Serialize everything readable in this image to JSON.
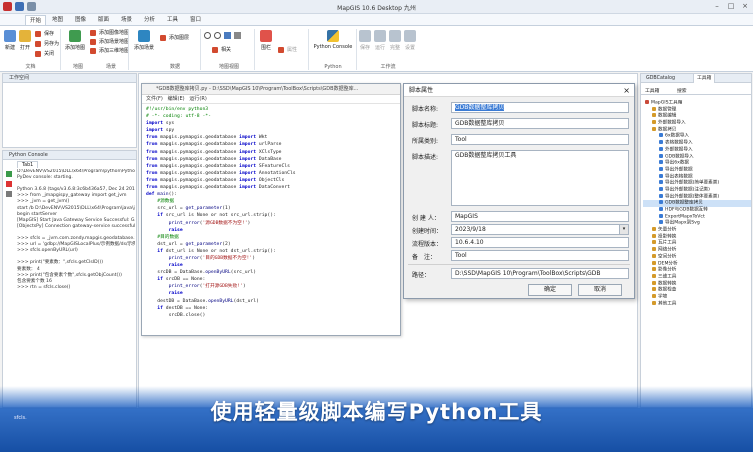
{
  "window": {
    "title": "MapGIS 10.6 Desktop 九州"
  },
  "ribbon_tabs": [
    "开始",
    "地图",
    "图像",
    "版面",
    "场景",
    "分析",
    "工具",
    "窗口"
  ],
  "ribbon": {
    "new": "新建",
    "open": "打开",
    "save": "保存",
    "save_as": "另存为",
    "close": "关闭",
    "group_doc": "文档",
    "add_map": "添加地图",
    "add_raster_map": "添加图像地图",
    "add_scene_map": "添加场景地图",
    "add_3d_map": "添加三维地图",
    "group_map": "地图",
    "group_map2": "场景",
    "add_scene": "添加场景",
    "add_layer": "添加图层",
    "group_data": "数据",
    "group_mapview": "地图视图",
    "related": "相关",
    "fence": "围栏",
    "property": "属性",
    "python_console": "Python Console",
    "group_python": "Python",
    "save2": "保存",
    "run": "运行",
    "stop": "完整",
    "settings": "设置",
    "group_workflow": "工作流"
  },
  "left_pane": {
    "title": "工作空间"
  },
  "console": {
    "title": "Python Console",
    "tab": "Tab1",
    "lines": [
      "D:\\DevENV\\VS2015\\DLL\\x64\\Program\\python\\Python36\\",
      "PyDev console: starting.",
      "",
      "Python 3.6.8 (tags/v3.6.8:3c6b436a57, Dec 24 2018, 00:16:47)",
      ">>> from _jmapgispy_gateway import get_jvm",
      ">>> _jvm = get_jvm()",
      "start /b D:\\DevENV\\VS2015\\DLL\\x64\\Program\\java\\jre",
      "begin startServer",
      "[MapGIS] Start Java Gateway Service Successful: GatewayServer",
      "[ObjectsPy] Connection gateway-service successful.",
      "",
      ">>> sfcls = _jvm.com.zondy.mapgis.geodatabase.SFeatureCls",
      ">>> url = 'gdbp://MapGISLocalPlus/示例数据/ds/示例数据",
      ">>> sfcls.openByURL(url)",
      "",
      ">>> print(\"要素数：\",sfcls.getClsID())",
      "要素数： 4",
      ">>> print(\"包含要素个数\",sfcls.getObjCount())",
      "包含要素个数 16",
      ">>> rtn = sfcls.close()"
    ],
    "input": "sfcls."
  },
  "editor": {
    "title": "*GDB数据整库拷贝.py - D:\\SSD\\MapGIS 10\\Program\\ToolBox\\Scripts\\GDB数据整库...",
    "menu": [
      "文件(F)",
      "编辑(E)",
      "运行(R)"
    ],
    "code": [
      [
        {
          "t": "#!/usr/bin/env python3",
          "c": "cm"
        }
      ],
      [
        {
          "t": "# -*- coding: utf-8 -*-",
          "c": "cm"
        }
      ],
      [
        {
          "t": "import",
          "c": "kw"
        },
        {
          "t": " sys"
        }
      ],
      [
        {
          "t": "import",
          "c": "kw"
        },
        {
          "t": " spy"
        }
      ],
      [
        {
          "t": "from",
          "c": "kw"
        },
        {
          "t": " mapgis.pymapgis.geodatabase "
        },
        {
          "t": "import",
          "c": "kw"
        },
        {
          "t": " Wkt"
        }
      ],
      [
        {
          "t": "from",
          "c": "kw"
        },
        {
          "t": " mapgis.pymapgis.geodatabase "
        },
        {
          "t": "import",
          "c": "kw"
        },
        {
          "t": " urlParse"
        }
      ],
      [
        {
          "t": "from",
          "c": "kw"
        },
        {
          "t": " mapgis.pymapgis.geodatabase "
        },
        {
          "t": "import",
          "c": "kw"
        },
        {
          "t": " XClsType"
        }
      ],
      [
        {
          "t": "from",
          "c": "kw"
        },
        {
          "t": " mapgis.pymapgis.geodatabase "
        },
        {
          "t": "import",
          "c": "kw"
        },
        {
          "t": " DataBase"
        }
      ],
      [
        {
          "t": "from",
          "c": "kw"
        },
        {
          "t": " mapgis.pymapgis.geodatabase "
        },
        {
          "t": "import",
          "c": "kw"
        },
        {
          "t": " SFeatureCls"
        }
      ],
      [
        {
          "t": "from",
          "c": "kw"
        },
        {
          "t": " mapgis.pymapgis.geodatabase "
        },
        {
          "t": "import",
          "c": "kw"
        },
        {
          "t": " AnnotationCls"
        }
      ],
      [
        {
          "t": "from",
          "c": "kw"
        },
        {
          "t": " mapgis.pymapgis.geodatabase "
        },
        {
          "t": "import",
          "c": "kw"
        },
        {
          "t": " ObjectCls"
        }
      ],
      [
        {
          "t": "from",
          "c": "kw"
        },
        {
          "t": " mapgis.pymapgis.geodatabase "
        },
        {
          "t": "import",
          "c": "kw"
        },
        {
          "t": " DataConvert"
        }
      ],
      [
        {
          "t": ""
        }
      ],
      [
        {
          "t": "def",
          "c": "kw"
        },
        {
          "t": " main",
          "c": "fn"
        },
        {
          "t": "():"
        }
      ],
      [
        {
          "t": "    #源数据",
          "c": "cm"
        }
      ],
      [
        {
          "t": "    src_url = "
        },
        {
          "t": "get_parameter",
          "c": "fn"
        },
        {
          "t": "(1)"
        }
      ],
      [
        {
          "t": "    "
        },
        {
          "t": "if",
          "c": "kw"
        },
        {
          "t": " src_url is None or not src_url.strip():"
        }
      ],
      [
        {
          "t": "        "
        },
        {
          "t": "print_error",
          "c": "fn"
        },
        {
          "t": "("
        },
        {
          "t": "'源GDB数据不为空!'",
          "c": "st"
        },
        {
          "t": ")"
        }
      ],
      [
        {
          "t": "        "
        },
        {
          "t": "raise",
          "c": "kw"
        }
      ],
      [
        {
          "t": "    #目的数据",
          "c": "cm"
        }
      ],
      [
        {
          "t": "    dst_url = "
        },
        {
          "t": "get_parameter",
          "c": "fn"
        },
        {
          "t": "(2)"
        }
      ],
      [
        {
          "t": "    "
        },
        {
          "t": "if",
          "c": "kw"
        },
        {
          "t": " dst_url is None or not dst_url.strip():"
        }
      ],
      [
        {
          "t": "        "
        },
        {
          "t": "print_error",
          "c": "fn"
        },
        {
          "t": "("
        },
        {
          "t": "'目的GDB数据不为空!'",
          "c": "st"
        },
        {
          "t": ")"
        }
      ],
      [
        {
          "t": "        "
        },
        {
          "t": "raise",
          "c": "kw"
        }
      ],
      [
        {
          "t": "    srcDB = DataBase."
        },
        {
          "t": "openByURL",
          "c": "fn"
        },
        {
          "t": "(src_url)"
        }
      ],
      [
        {
          "t": "    "
        },
        {
          "t": "if",
          "c": "kw"
        },
        {
          "t": " srcDB == None:"
        }
      ],
      [
        {
          "t": "        "
        },
        {
          "t": "print_error",
          "c": "fn"
        },
        {
          "t": "("
        },
        {
          "t": "'打开源GDB失败!'",
          "c": "st"
        },
        {
          "t": ")"
        }
      ],
      [
        {
          "t": "        "
        },
        {
          "t": "raise",
          "c": "kw"
        }
      ],
      [
        {
          "t": "    destDB = DataBase."
        },
        {
          "t": "openByURL",
          "c": "fn"
        },
        {
          "t": "(dst_url)"
        }
      ],
      [
        {
          "t": "    "
        },
        {
          "t": "if",
          "c": "kw"
        },
        {
          "t": " destDB == None:"
        }
      ],
      [
        {
          "t": "        srcDB.close()"
        }
      ]
    ]
  },
  "dialog": {
    "title": "脚本属性",
    "name_label": "脚本名称:",
    "name_value": "GDB数据整库拷贝",
    "title_label": "脚本标题:",
    "title_value": "GDB数据整库拷贝",
    "category_label": "所属类别:",
    "category_value": "Tool",
    "desc_label": "脚本描述:",
    "desc_value": "GDB数据整库拷贝工具",
    "creator_label": "创 建 人：",
    "creator_value": "MapGIS",
    "created_label": "创建时间：",
    "created_value": "2023/9/18",
    "version_label": "流程版本：",
    "version_value": "10.6.4.10",
    "note_label": "备　注：",
    "note_value": "Tool",
    "path_label": "路径：",
    "path_value": "D:\\SSD\\MapGIS 10\\Program\\ToolBox\\Scripts\\GDB",
    "ok": "确定",
    "cancel": "取消"
  },
  "right_pane": {
    "tab1": "GDBCatalog",
    "tab2": "工具箱",
    "subtab1": "工具箱",
    "subtab2": "搜索",
    "tree": [
      {
        "label": "MapGIS工具箱",
        "level": 0
      },
      {
        "label": "数据管理",
        "level": 1
      },
      {
        "label": "数据编辑",
        "level": 1
      },
      {
        "label": "外部数据导入",
        "level": 1
      },
      {
        "label": "数据拷贝",
        "level": 1
      },
      {
        "label": "6x数据导入",
        "level": 2
      },
      {
        "label": "表格数据导入",
        "level": 2
      },
      {
        "label": "外部数据导入",
        "level": 2
      },
      {
        "label": "GDB数据导入",
        "level": 2
      },
      {
        "label": "导出6x数据",
        "level": 2
      },
      {
        "label": "导出外部数据",
        "level": 2
      },
      {
        "label": "导出表格数据",
        "level": 2
      },
      {
        "label": "导出外部数据(简单要素类)",
        "level": 2
      },
      {
        "label": "导出外部数据(注记类)",
        "level": 2
      },
      {
        "label": "导出外部数据(整体要素类)",
        "level": 2
      },
      {
        "label": "GDB数据整库拷贝",
        "level": 2,
        "selected": true
      },
      {
        "label": "HDF与GDB数据互转",
        "level": 2
      },
      {
        "label": "ExportMapxToVct",
        "level": 2
      },
      {
        "label": "导出Mapx到Svg",
        "level": 2
      },
      {
        "label": "矢量分析",
        "level": 1
      },
      {
        "label": "投影转换",
        "level": 1
      },
      {
        "label": "瓦片工具",
        "level": 1
      },
      {
        "label": "网络分析",
        "level": 1
      },
      {
        "label": "空间分析",
        "level": 1
      },
      {
        "label": "DEM分析",
        "level": 1
      },
      {
        "label": "影像分析",
        "level": 1
      },
      {
        "label": "三维工具",
        "level": 1
      },
      {
        "label": "数据转换",
        "level": 1
      },
      {
        "label": "数据检查",
        "level": 1
      },
      {
        "label": "学坡",
        "level": 1
      },
      {
        "label": "其他工具",
        "level": 1
      }
    ]
  },
  "banner": {
    "text": "使用轻量级脚本编写Python工具"
  }
}
